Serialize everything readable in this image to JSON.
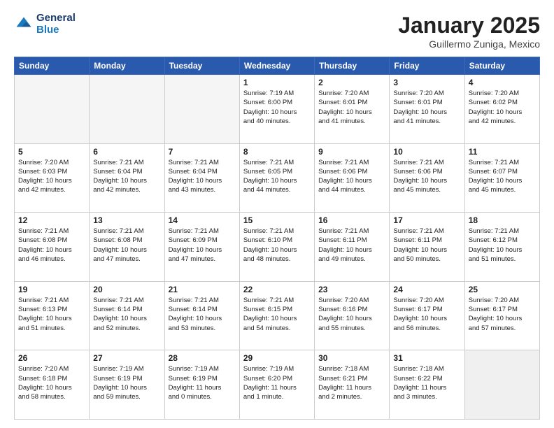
{
  "header": {
    "logo_line1": "General",
    "logo_line2": "Blue",
    "title": "January 2025",
    "subtitle": "Guillermo Zuniga, Mexico"
  },
  "days_of_week": [
    "Sunday",
    "Monday",
    "Tuesday",
    "Wednesday",
    "Thursday",
    "Friday",
    "Saturday"
  ],
  "weeks": [
    [
      {
        "num": "",
        "info": "",
        "empty": true
      },
      {
        "num": "",
        "info": "",
        "empty": true
      },
      {
        "num": "",
        "info": "",
        "empty": true
      },
      {
        "num": "1",
        "info": "Sunrise: 7:19 AM\nSunset: 6:00 PM\nDaylight: 10 hours\nand 40 minutes.",
        "empty": false
      },
      {
        "num": "2",
        "info": "Sunrise: 7:20 AM\nSunset: 6:01 PM\nDaylight: 10 hours\nand 41 minutes.",
        "empty": false
      },
      {
        "num": "3",
        "info": "Sunrise: 7:20 AM\nSunset: 6:01 PM\nDaylight: 10 hours\nand 41 minutes.",
        "empty": false
      },
      {
        "num": "4",
        "info": "Sunrise: 7:20 AM\nSunset: 6:02 PM\nDaylight: 10 hours\nand 42 minutes.",
        "empty": false
      }
    ],
    [
      {
        "num": "5",
        "info": "Sunrise: 7:20 AM\nSunset: 6:03 PM\nDaylight: 10 hours\nand 42 minutes.",
        "empty": false
      },
      {
        "num": "6",
        "info": "Sunrise: 7:21 AM\nSunset: 6:04 PM\nDaylight: 10 hours\nand 42 minutes.",
        "empty": false
      },
      {
        "num": "7",
        "info": "Sunrise: 7:21 AM\nSunset: 6:04 PM\nDaylight: 10 hours\nand 43 minutes.",
        "empty": false
      },
      {
        "num": "8",
        "info": "Sunrise: 7:21 AM\nSunset: 6:05 PM\nDaylight: 10 hours\nand 44 minutes.",
        "empty": false
      },
      {
        "num": "9",
        "info": "Sunrise: 7:21 AM\nSunset: 6:06 PM\nDaylight: 10 hours\nand 44 minutes.",
        "empty": false
      },
      {
        "num": "10",
        "info": "Sunrise: 7:21 AM\nSunset: 6:06 PM\nDaylight: 10 hours\nand 45 minutes.",
        "empty": false
      },
      {
        "num": "11",
        "info": "Sunrise: 7:21 AM\nSunset: 6:07 PM\nDaylight: 10 hours\nand 45 minutes.",
        "empty": false
      }
    ],
    [
      {
        "num": "12",
        "info": "Sunrise: 7:21 AM\nSunset: 6:08 PM\nDaylight: 10 hours\nand 46 minutes.",
        "empty": false
      },
      {
        "num": "13",
        "info": "Sunrise: 7:21 AM\nSunset: 6:08 PM\nDaylight: 10 hours\nand 47 minutes.",
        "empty": false
      },
      {
        "num": "14",
        "info": "Sunrise: 7:21 AM\nSunset: 6:09 PM\nDaylight: 10 hours\nand 47 minutes.",
        "empty": false
      },
      {
        "num": "15",
        "info": "Sunrise: 7:21 AM\nSunset: 6:10 PM\nDaylight: 10 hours\nand 48 minutes.",
        "empty": false
      },
      {
        "num": "16",
        "info": "Sunrise: 7:21 AM\nSunset: 6:11 PM\nDaylight: 10 hours\nand 49 minutes.",
        "empty": false
      },
      {
        "num": "17",
        "info": "Sunrise: 7:21 AM\nSunset: 6:11 PM\nDaylight: 10 hours\nand 50 minutes.",
        "empty": false
      },
      {
        "num": "18",
        "info": "Sunrise: 7:21 AM\nSunset: 6:12 PM\nDaylight: 10 hours\nand 51 minutes.",
        "empty": false
      }
    ],
    [
      {
        "num": "19",
        "info": "Sunrise: 7:21 AM\nSunset: 6:13 PM\nDaylight: 10 hours\nand 51 minutes.",
        "empty": false
      },
      {
        "num": "20",
        "info": "Sunrise: 7:21 AM\nSunset: 6:14 PM\nDaylight: 10 hours\nand 52 minutes.",
        "empty": false
      },
      {
        "num": "21",
        "info": "Sunrise: 7:21 AM\nSunset: 6:14 PM\nDaylight: 10 hours\nand 53 minutes.",
        "empty": false
      },
      {
        "num": "22",
        "info": "Sunrise: 7:21 AM\nSunset: 6:15 PM\nDaylight: 10 hours\nand 54 minutes.",
        "empty": false
      },
      {
        "num": "23",
        "info": "Sunrise: 7:20 AM\nSunset: 6:16 PM\nDaylight: 10 hours\nand 55 minutes.",
        "empty": false
      },
      {
        "num": "24",
        "info": "Sunrise: 7:20 AM\nSunset: 6:17 PM\nDaylight: 10 hours\nand 56 minutes.",
        "empty": false
      },
      {
        "num": "25",
        "info": "Sunrise: 7:20 AM\nSunset: 6:17 PM\nDaylight: 10 hours\nand 57 minutes.",
        "empty": false
      }
    ],
    [
      {
        "num": "26",
        "info": "Sunrise: 7:20 AM\nSunset: 6:18 PM\nDaylight: 10 hours\nand 58 minutes.",
        "empty": false
      },
      {
        "num": "27",
        "info": "Sunrise: 7:19 AM\nSunset: 6:19 PM\nDaylight: 10 hours\nand 59 minutes.",
        "empty": false
      },
      {
        "num": "28",
        "info": "Sunrise: 7:19 AM\nSunset: 6:19 PM\nDaylight: 11 hours\nand 0 minutes.",
        "empty": false
      },
      {
        "num": "29",
        "info": "Sunrise: 7:19 AM\nSunset: 6:20 PM\nDaylight: 11 hours\nand 1 minute.",
        "empty": false
      },
      {
        "num": "30",
        "info": "Sunrise: 7:18 AM\nSunset: 6:21 PM\nDaylight: 11 hours\nand 2 minutes.",
        "empty": false
      },
      {
        "num": "31",
        "info": "Sunrise: 7:18 AM\nSunset: 6:22 PM\nDaylight: 11 hours\nand 3 minutes.",
        "empty": false
      },
      {
        "num": "",
        "info": "",
        "empty": true,
        "shaded": true
      }
    ]
  ]
}
